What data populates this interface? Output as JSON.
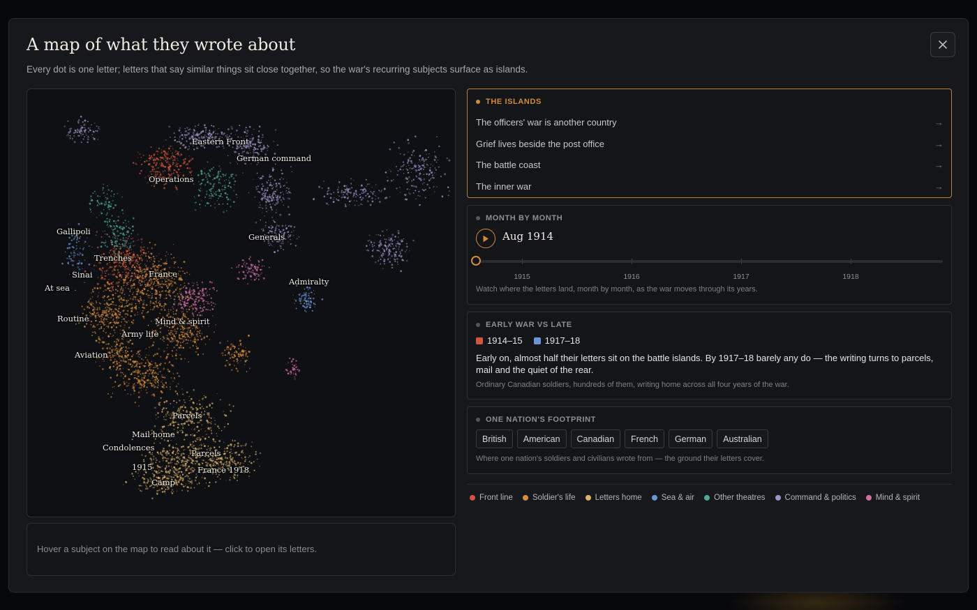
{
  "modal": {
    "title": "A map of what they wrote about",
    "subtitle": "Every dot is one letter; letters that say similar things sit close together, so the war's recurring subjects surface as islands.",
    "close_icon": "close-icon"
  },
  "map": {
    "labels": [
      {
        "id": "eastern-front",
        "text": "Eastern Front"
      },
      {
        "id": "german-command",
        "text": "German command"
      },
      {
        "id": "operations",
        "text": "Operations"
      },
      {
        "id": "gallipoli",
        "text": "Gallipoli"
      },
      {
        "id": "generals",
        "text": "Generals"
      },
      {
        "id": "trenches",
        "text": "Trenches"
      },
      {
        "id": "sinai",
        "text": "Sinai"
      },
      {
        "id": "france",
        "text": "France"
      },
      {
        "id": "admiralty",
        "text": "Admiralty"
      },
      {
        "id": "at-sea",
        "text": "At sea"
      },
      {
        "id": "routine",
        "text": "Routine"
      },
      {
        "id": "mind-spirit",
        "text": "Mind & spirit"
      },
      {
        "id": "army-life",
        "text": "Army life"
      },
      {
        "id": "aviation",
        "text": "Aviation"
      },
      {
        "id": "parcels-1",
        "text": "Parcels"
      },
      {
        "id": "mail-home",
        "text": "Mail home"
      },
      {
        "id": "condolences",
        "text": "Condolences"
      },
      {
        "id": "parcels-2",
        "text": "Parcels"
      },
      {
        "id": "y1915",
        "text": "1915"
      },
      {
        "id": "france-1918",
        "text": "France 1918"
      },
      {
        "id": "camp",
        "text": "Camp"
      }
    ],
    "hover_hint": "Hover a subject on the map to read about it — click to open its letters."
  },
  "islands": {
    "heading": "THE ISLANDS",
    "accent": "#d18c3a",
    "items": [
      {
        "label": "The officers' war is another country",
        "arrow": "→"
      },
      {
        "label": "Grief lives beside the post office",
        "arrow": "→"
      },
      {
        "label": "The battle coast",
        "arrow": "→"
      },
      {
        "label": "The inner war",
        "arrow": "→"
      }
    ]
  },
  "month": {
    "heading": "MONTH BY MONTH",
    "current": "Aug 1914",
    "progress": 0,
    "ticks": [
      "1915",
      "1916",
      "1917",
      "1918"
    ],
    "note": "Watch where the letters land, month by month, as the war moves through its years."
  },
  "early": {
    "heading": "EARLY WAR VS LATE",
    "early_label": "1914–15",
    "early_color": "#d2573a",
    "late_label": "1917–18",
    "late_color": "#6a95d6",
    "text": "Early on, almost half their letters sit on the battle islands. By 1917–18 barely any do — the writing turns to parcels, mail and the quiet of the rear.",
    "note": "Ordinary Canadian soldiers, hundreds of them, writing home across all four years of the war."
  },
  "footprint": {
    "heading": "ONE NATION'S FOOTPRINT",
    "chips": [
      "British",
      "American",
      "Canadian",
      "French",
      "German",
      "Australian"
    ],
    "note": "Where one nation's soldiers and civilians wrote from — the ground their letters cover."
  },
  "legend": [
    {
      "label": "Front line",
      "color": "#d2573a"
    },
    {
      "label": "Soldier's life",
      "color": "#d78d3c"
    },
    {
      "label": "Letters home",
      "color": "#d9b169"
    },
    {
      "label": "Sea & air",
      "color": "#6a95d6"
    },
    {
      "label": "Other theatres",
      "color": "#4fa89d"
    },
    {
      "label": "Command & politics",
      "color": "#9d93c8"
    },
    {
      "label": "Mind & spirit",
      "color": "#cf6da3"
    }
  ]
}
